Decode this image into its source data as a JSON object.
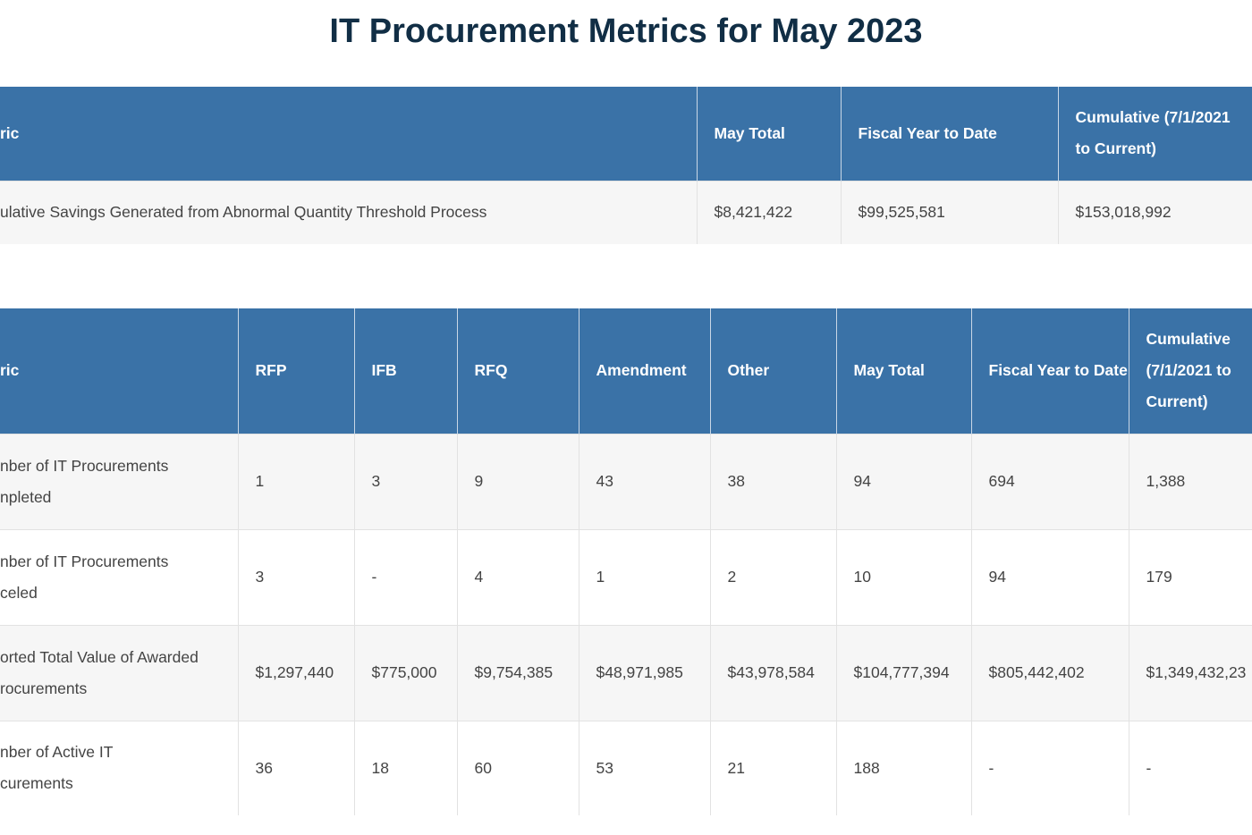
{
  "title": "IT Procurement Metrics for May 2023",
  "colors": {
    "header_bg": "#3a72a7",
    "title": "#112e45",
    "stripe": "#f6f6f6"
  },
  "table1": {
    "headers": [
      "ric",
      "May Total",
      "Fiscal Year to Date",
      "Cumulative (7/1/2021 to Current)"
    ],
    "rows": [
      [
        "ulative Savings Generated from Abnormal Quantity Threshold Process",
        "$8,421,422",
        "$99,525,581",
        "$153,018,992"
      ]
    ]
  },
  "table2": {
    "headers": [
      "ric",
      "RFP",
      "IFB",
      "RFQ",
      "Amendment",
      "Other",
      "May Total",
      "Fiscal Year to Date",
      "Cumulative (7/1/2021 to Current)"
    ],
    "rows": [
      [
        "nber of IT Procurements npleted",
        "1",
        "3",
        "9",
        "43",
        "38",
        "94",
        "694",
        "1,388"
      ],
      [
        "nber of IT Procurements celed",
        "3",
        "-",
        "4",
        "1",
        "2",
        "10",
        "94",
        "179"
      ],
      [
        "orted Total Value of Awarded rocurements",
        "$1,297,440",
        "$775,000",
        "$9,754,385",
        "$48,971,985",
        "$43,978,584",
        "$104,777,394",
        "$805,442,402",
        "$1,349,432,23"
      ],
      [
        "nber of Active IT curements",
        "36",
        "18",
        "60",
        "53",
        "21",
        "188",
        "-",
        "-"
      ]
    ]
  }
}
